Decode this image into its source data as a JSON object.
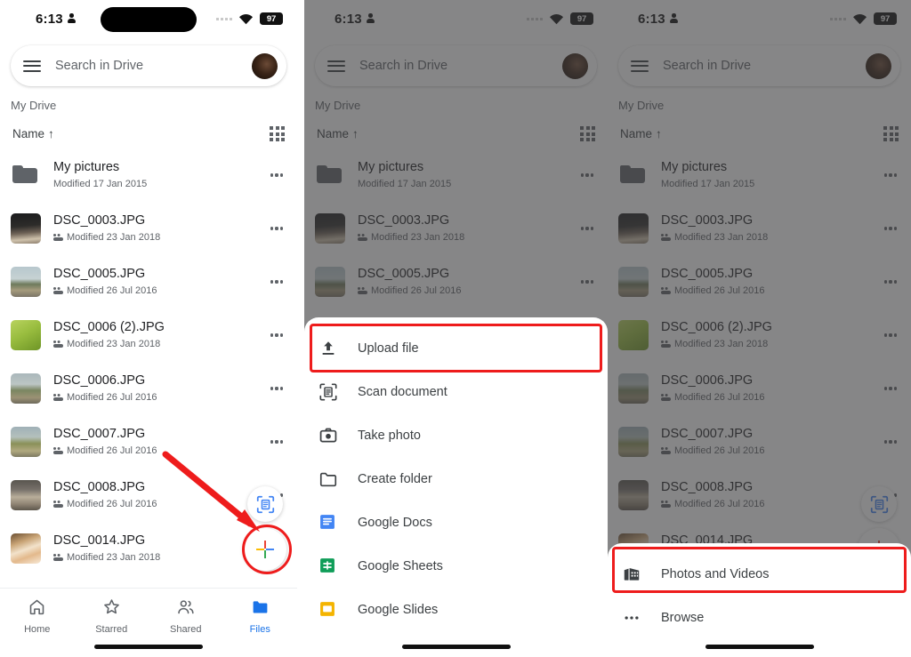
{
  "status_bar": {
    "time": "6:13",
    "person_icon": "person-icon",
    "signal_icon": "signal-dots-icon",
    "wifi_icon": "wifi-icon",
    "battery_level": "97"
  },
  "search": {
    "menu_icon": "hamburger-menu-icon",
    "placeholder": "Search in Drive",
    "avatar": "account-avatar"
  },
  "breadcrumb": "My Drive",
  "sort": {
    "label": "Name",
    "direction_arrow": "↑",
    "view_toggle_icon": "grid-view-icon"
  },
  "files": [
    {
      "name": "My pictures",
      "meta": "Modified 17 Jan 2015",
      "shared": false,
      "thumb": "folder"
    },
    {
      "name": "DSC_0003.JPG",
      "meta": "Modified 23 Jan 2018",
      "shared": true,
      "thumb": "t-road"
    },
    {
      "name": "DSC_0005.JPG",
      "meta": "Modified 26 Jul 2016",
      "shared": true,
      "thumb": "t-field"
    },
    {
      "name": "DSC_0006 (2).JPG",
      "meta": "Modified 23 Jan 2018",
      "shared": true,
      "thumb": "t-leaf"
    },
    {
      "name": "DSC_0006.JPG",
      "meta": "Modified 26 Jul 2016",
      "shared": true,
      "thumb": "t-field2"
    },
    {
      "name": "DSC_0007.JPG",
      "meta": "Modified 26 Jul 2016",
      "shared": true,
      "thumb": "t-field3"
    },
    {
      "name": "DSC_0008.JPG",
      "meta": "Modified 26 Jul 2016",
      "shared": true,
      "thumb": "t-grass"
    },
    {
      "name": "DSC_0014.JPG",
      "meta": "Modified 23 Jan 2018",
      "shared": true,
      "thumb": "t-food"
    }
  ],
  "fabs": {
    "scan_icon": "document-scan-icon",
    "add_icon": "plus-icon"
  },
  "bottom_nav": [
    {
      "label": "Home",
      "icon": "home-icon",
      "active": false
    },
    {
      "label": "Starred",
      "icon": "star-icon",
      "active": false
    },
    {
      "label": "Shared",
      "icon": "people-icon",
      "active": false
    },
    {
      "label": "Files",
      "icon": "folder-icon",
      "active": true
    }
  ],
  "create_sheet": {
    "items": [
      {
        "label": "Upload file",
        "icon": "upload-icon",
        "highlighted": true
      },
      {
        "label": "Scan document",
        "icon": "document-scan-icon",
        "highlighted": false
      },
      {
        "label": "Take photo",
        "icon": "camera-icon",
        "highlighted": false
      },
      {
        "label": "Create folder",
        "icon": "folder-outline-icon",
        "highlighted": false
      },
      {
        "label": "Google Docs",
        "icon": "google-docs-icon",
        "highlighted": false
      },
      {
        "label": "Google Sheets",
        "icon": "google-sheets-icon",
        "highlighted": false
      },
      {
        "label": "Google Slides",
        "icon": "google-slides-icon",
        "highlighted": false
      }
    ]
  },
  "picker_sheet": {
    "items": [
      {
        "label": "Photos and Videos",
        "icon": "photo-library-icon",
        "highlighted": true
      },
      {
        "label": "Browse",
        "icon": "more-horiz-icon",
        "highlighted": false
      }
    ]
  },
  "colors": {
    "accent_blue": "#1a73e8",
    "highlight_red": "#ee1c1c",
    "google_red": "#ea4335",
    "google_yellow": "#fbbc04",
    "google_green": "#34a853",
    "google_blue": "#4285f4",
    "docs_blue": "#4285f4",
    "sheets_green": "#0f9d58",
    "slides_yellow": "#f4b400",
    "text_primary": "#202124",
    "text_secondary": "#5f6368"
  }
}
